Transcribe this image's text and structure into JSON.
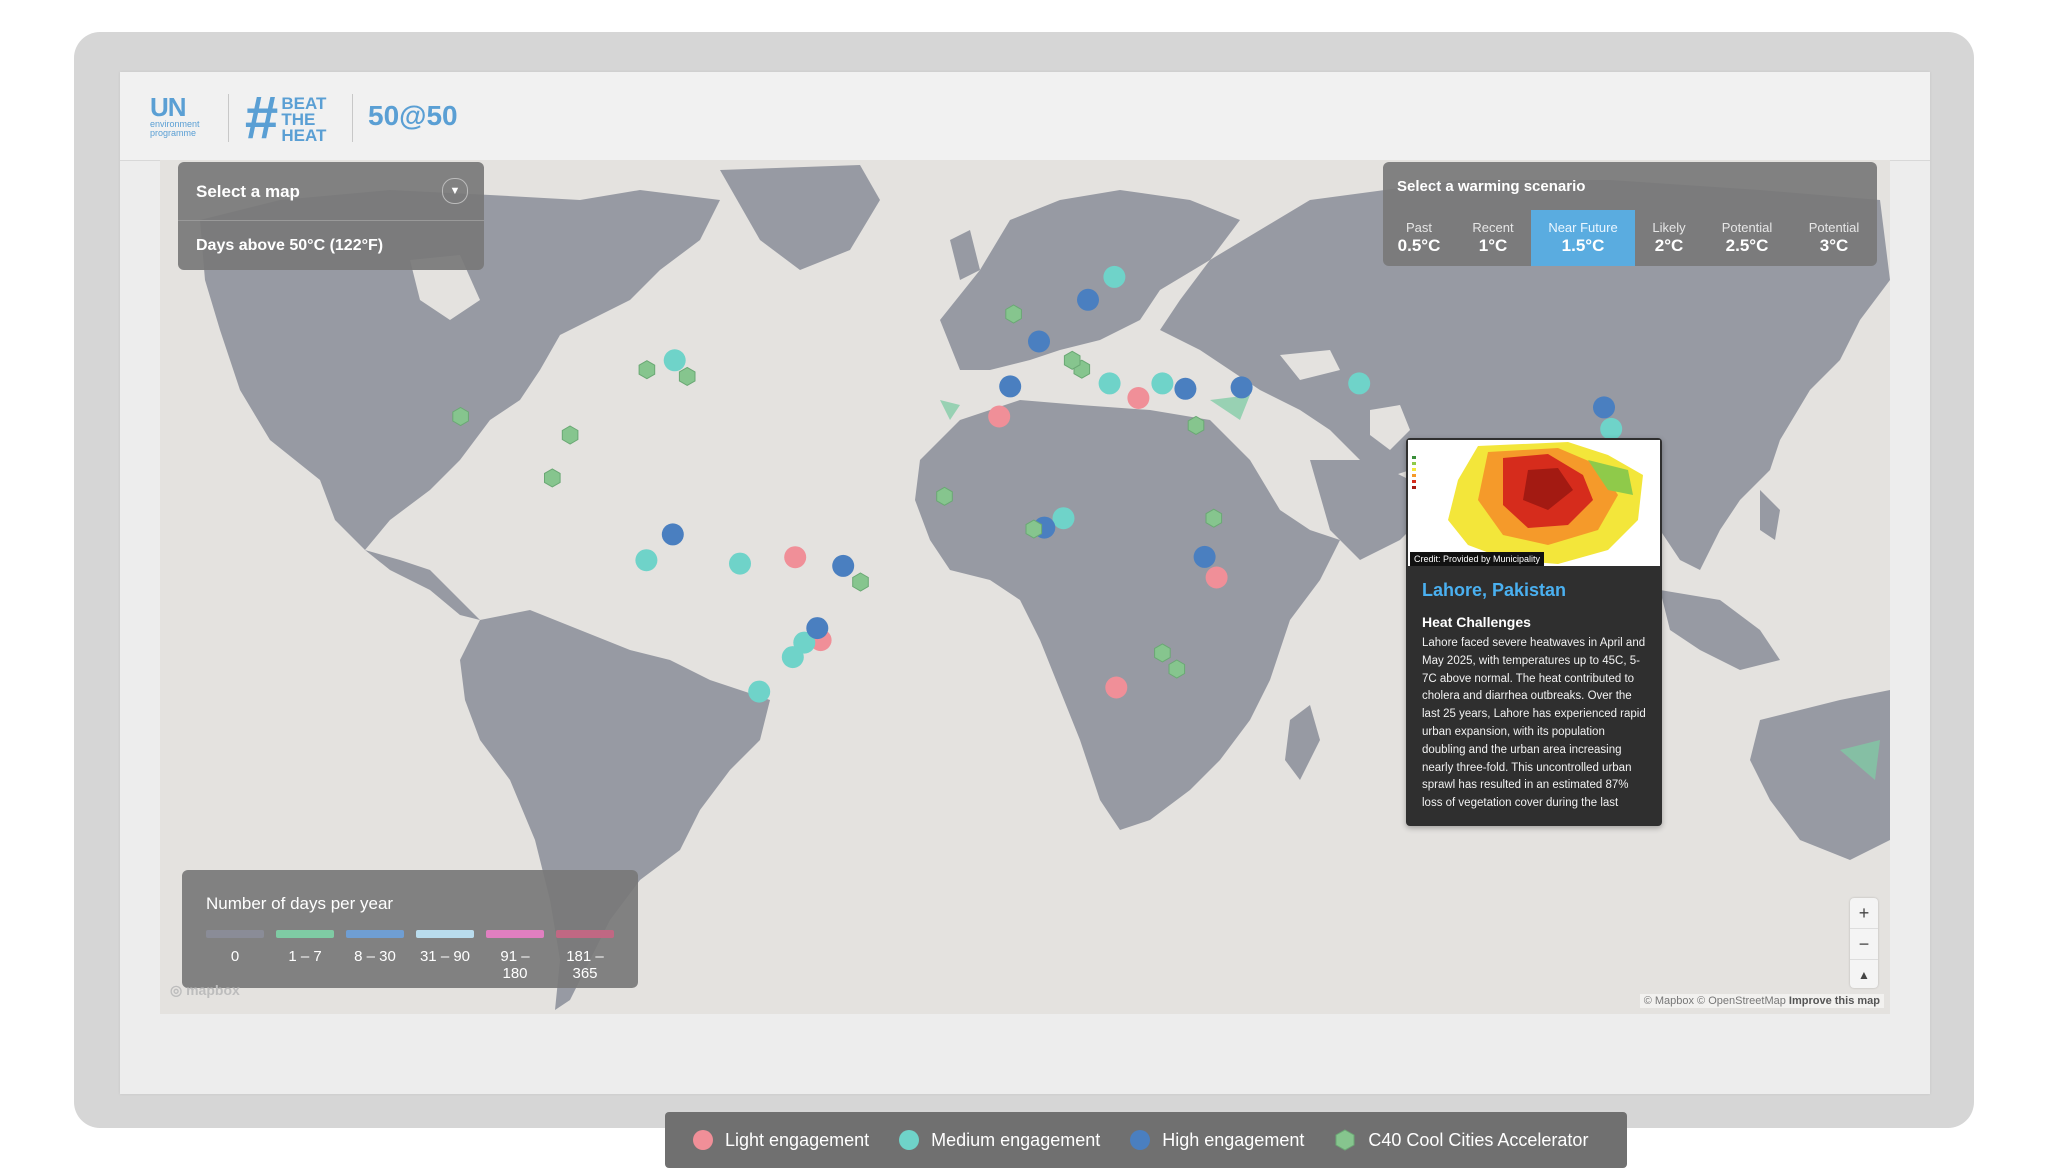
{
  "header": {
    "un_logo_text": "UN",
    "un_logo_sub1": "environment",
    "un_logo_sub2": "programme",
    "campaign_hash": "#",
    "campaign_word1": "BEAT",
    "campaign_word2": "THE",
    "campaign_word3": "HEAT",
    "campaign_name": "50@50"
  },
  "map_select": {
    "title": "Select a map",
    "selected": "Days above 50°C (122°F)"
  },
  "scenario": {
    "title": "Select a warming scenario",
    "options": [
      {
        "label": "Past",
        "value": "0.5°C",
        "active": false
      },
      {
        "label": "Recent",
        "value": "1°C",
        "active": false
      },
      {
        "label": "Near Future",
        "value": "1.5°C",
        "active": true
      },
      {
        "label": "Likely",
        "value": "2°C",
        "active": false
      },
      {
        "label": "Potential",
        "value": "2.5°C",
        "active": false
      },
      {
        "label": "Potential",
        "value": "3°C",
        "active": false
      }
    ]
  },
  "days_legend": {
    "title": "Number of days per year",
    "items": [
      {
        "label": "0",
        "color": "#8a8c97"
      },
      {
        "label": "1 – 7",
        "color": "#7fcba4"
      },
      {
        "label": "8 – 30",
        "color": "#6f9ed3"
      },
      {
        "label": "31 – 90",
        "color": "#b9dced"
      },
      {
        "label": "91 – 180",
        "color": "#e07fc0"
      },
      {
        "label": "181 – 365",
        "color": "#c06883"
      }
    ]
  },
  "popup": {
    "image_credit": "Credit: Provided by Municipality",
    "city": "Lahore, Pakistan",
    "heading": "Heat Challenges",
    "body": "Lahore faced severe heatwaves in April and May 2025, with temperatures up to 45C, 5-7C above normal. The heat contributed to cholera and diarrhea outbreaks. Over the last 25 years, Lahore has experienced rapid urban expansion, with its population doubling and the urban area increasing nearly three-fold. This uncontrolled urban sprawl has resulted in an estimated 87% loss of vegetation cover during the last"
  },
  "attribution": {
    "mapbox_logo": "mapbox",
    "text": "© Mapbox © OpenStreetMap",
    "improve": "Improve this map"
  },
  "zoom": {
    "in": "+",
    "out": "−",
    "compass": "▲"
  },
  "engagement_legend": {
    "items": [
      {
        "label": "Light engagement",
        "color": "#f08f98",
        "shape": "circle"
      },
      {
        "label": "Medium engagement",
        "color": "#6fd3c9",
        "shape": "circle"
      },
      {
        "label": "High engagement",
        "color": "#4a7fc0",
        "shape": "circle"
      },
      {
        "label": "C40 Cool Cities Accelerator",
        "color": "#86c58e",
        "shape": "hexagon"
      }
    ]
  },
  "markers": [
    {
      "city_type": "light",
      "lon": -6,
      "lat": 34
    },
    {
      "city_type": "light",
      "lon": 23,
      "lat": 38
    },
    {
      "city_type": "light",
      "lon": 18.4,
      "lat": -34
    },
    {
      "city_type": "light",
      "lon": -48.5,
      "lat": -1.4
    },
    {
      "city_type": "light",
      "lon": -43.2,
      "lat": -22.9
    },
    {
      "city_type": "light",
      "lon": 39.3,
      "lat": -6.8
    },
    {
      "city_type": "medium",
      "lon": -73.6,
      "lat": 45.5
    },
    {
      "city_type": "medium",
      "lon": 18,
      "lat": 59
    },
    {
      "city_type": "medium",
      "lon": 17,
      "lat": 41
    },
    {
      "city_type": "medium",
      "lon": 28,
      "lat": 41
    },
    {
      "city_type": "medium",
      "lon": 7.4,
      "lat": 9
    },
    {
      "city_type": "medium",
      "lon": -79.5,
      "lat": -2.2
    },
    {
      "city_type": "medium",
      "lon": -60,
      "lat": -3.1
    },
    {
      "city_type": "medium",
      "lon": -46.6,
      "lat": -23.5
    },
    {
      "city_type": "medium",
      "lon": -49,
      "lat": -27
    },
    {
      "city_type": "medium",
      "lon": -56,
      "lat": -34.9
    },
    {
      "city_type": "medium",
      "lon": 69,
      "lat": 41
    },
    {
      "city_type": "medium",
      "lon": 121.5,
      "lat": 31.2
    },
    {
      "city_type": "medium",
      "lon": 120.9,
      "lat": 14.6
    },
    {
      "city_type": "medium",
      "lon": 106.8,
      "lat": -6.2
    },
    {
      "city_type": "high",
      "lon": 12.5,
      "lat": 55.7
    },
    {
      "city_type": "high",
      "lon": 2.3,
      "lat": 48.9
    },
    {
      "city_type": "high",
      "lon": -3.7,
      "lat": 40.4
    },
    {
      "city_type": "high",
      "lon": 32.8,
      "lat": 39.9
    },
    {
      "city_type": "high",
      "lon": 44.5,
      "lat": 40.2
    },
    {
      "city_type": "high",
      "lon": -74,
      "lat": 4.7
    },
    {
      "city_type": "high",
      "lon": 3.4,
      "lat": 6.5
    },
    {
      "city_type": "high",
      "lon": -38.5,
      "lat": -3.7
    },
    {
      "city_type": "high",
      "lon": -43.9,
      "lat": -19.9
    },
    {
      "city_type": "high",
      "lon": 36.8,
      "lat": -1.3
    },
    {
      "city_type": "high",
      "lon": 120,
      "lat": 36
    },
    {
      "city_type": "c40",
      "lon": -3,
      "lat": 53.5
    },
    {
      "city_type": "c40",
      "lon": 11.2,
      "lat": 43.8
    },
    {
      "city_type": "c40",
      "lon": 9.2,
      "lat": 45.5
    },
    {
      "city_type": "c40",
      "lon": 35,
      "lat": 32
    },
    {
      "city_type": "c40",
      "lon": -79.4,
      "lat": 43.7
    },
    {
      "city_type": "c40",
      "lon": -71,
      "lat": 42.4
    },
    {
      "city_type": "c40",
      "lon": -118.2,
      "lat": 34
    },
    {
      "city_type": "c40",
      "lon": -95.4,
      "lat": 29.8
    },
    {
      "city_type": "c40",
      "lon": -99.1,
      "lat": 19.4
    },
    {
      "city_type": "c40",
      "lon": -17.4,
      "lat": 14.7
    },
    {
      "city_type": "c40",
      "lon": 1.2,
      "lat": 6.1
    },
    {
      "city_type": "c40",
      "lon": -34.9,
      "lat": -8
    },
    {
      "city_type": "c40",
      "lon": 28,
      "lat": -26
    },
    {
      "city_type": "c40",
      "lon": 31,
      "lat": -29.8
    },
    {
      "city_type": "c40",
      "lon": 103.8,
      "lat": 1.4
    },
    {
      "city_type": "c40",
      "lon": 38.7,
      "lat": 9
    }
  ]
}
